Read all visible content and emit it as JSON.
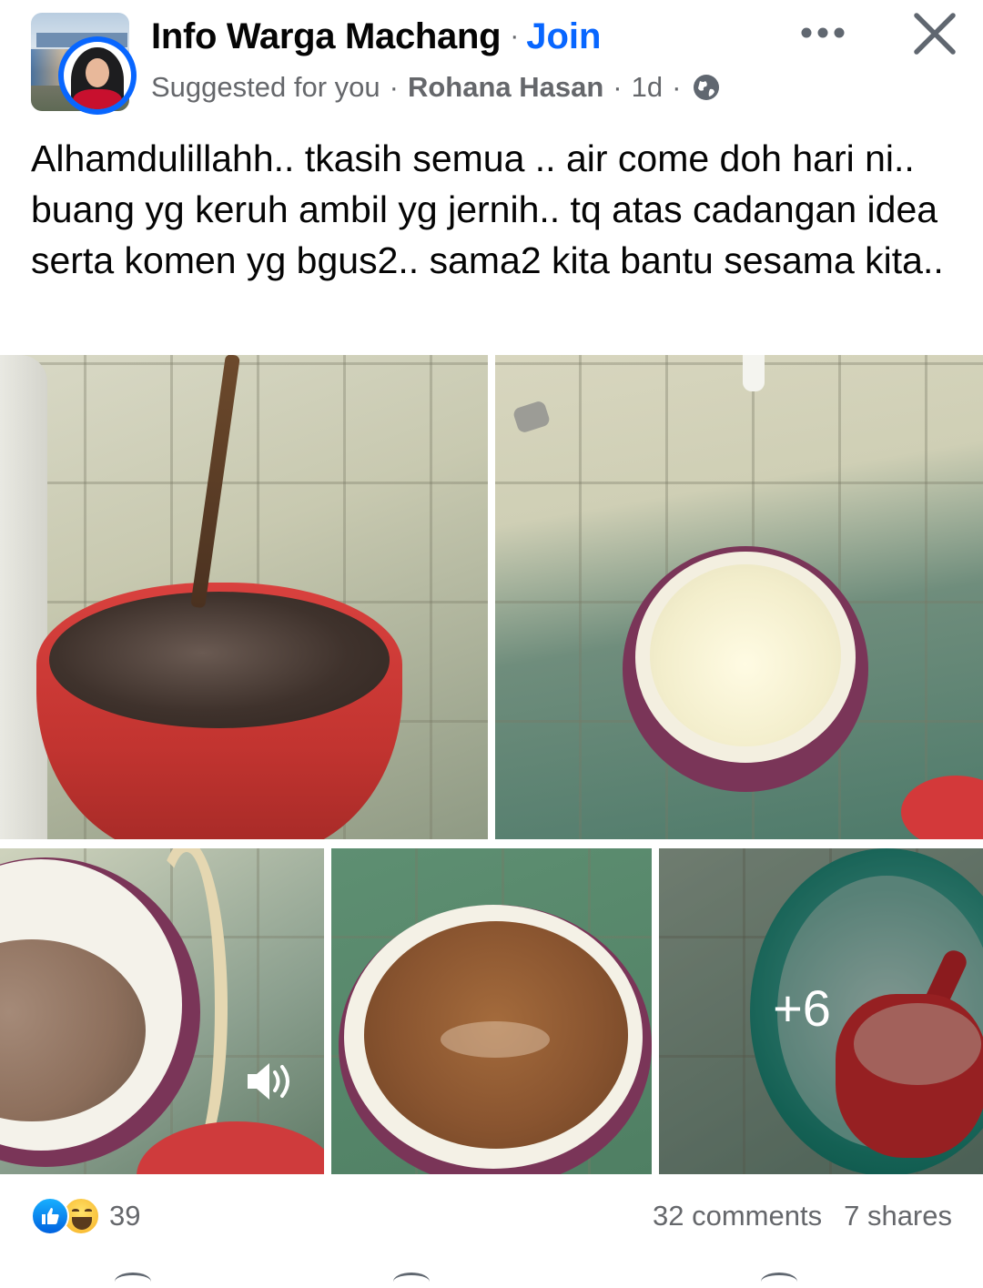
{
  "header": {
    "group_name": "Info Warga Machang",
    "separator": "·",
    "join_label": "Join",
    "suggested_label": "Suggested for you",
    "author": "Rohana Hasan",
    "time": "1d",
    "privacy_icon": "globe-icon",
    "more_icon": "more-dots-icon",
    "close_icon": "close-icon"
  },
  "post": {
    "text": "Alhamdulillahh.. tkasih semua .. air come doh hari ni.. buang yg keruh ambil yg jernih.. tq atas cadangan idea serta komen yg bgus2.. sama2 kita bantu sesama kita.."
  },
  "media": {
    "more_count": "+6",
    "video_sound_icon": "speaker-icon"
  },
  "footer": {
    "reaction_count": "39",
    "comments": "32 comments",
    "shares": "7 shares",
    "reaction_icons": [
      "like-icon",
      "haha-icon"
    ]
  },
  "colors": {
    "accent": "#0866ff",
    "secondary_text": "#65676b",
    "primary_text": "#050505"
  }
}
